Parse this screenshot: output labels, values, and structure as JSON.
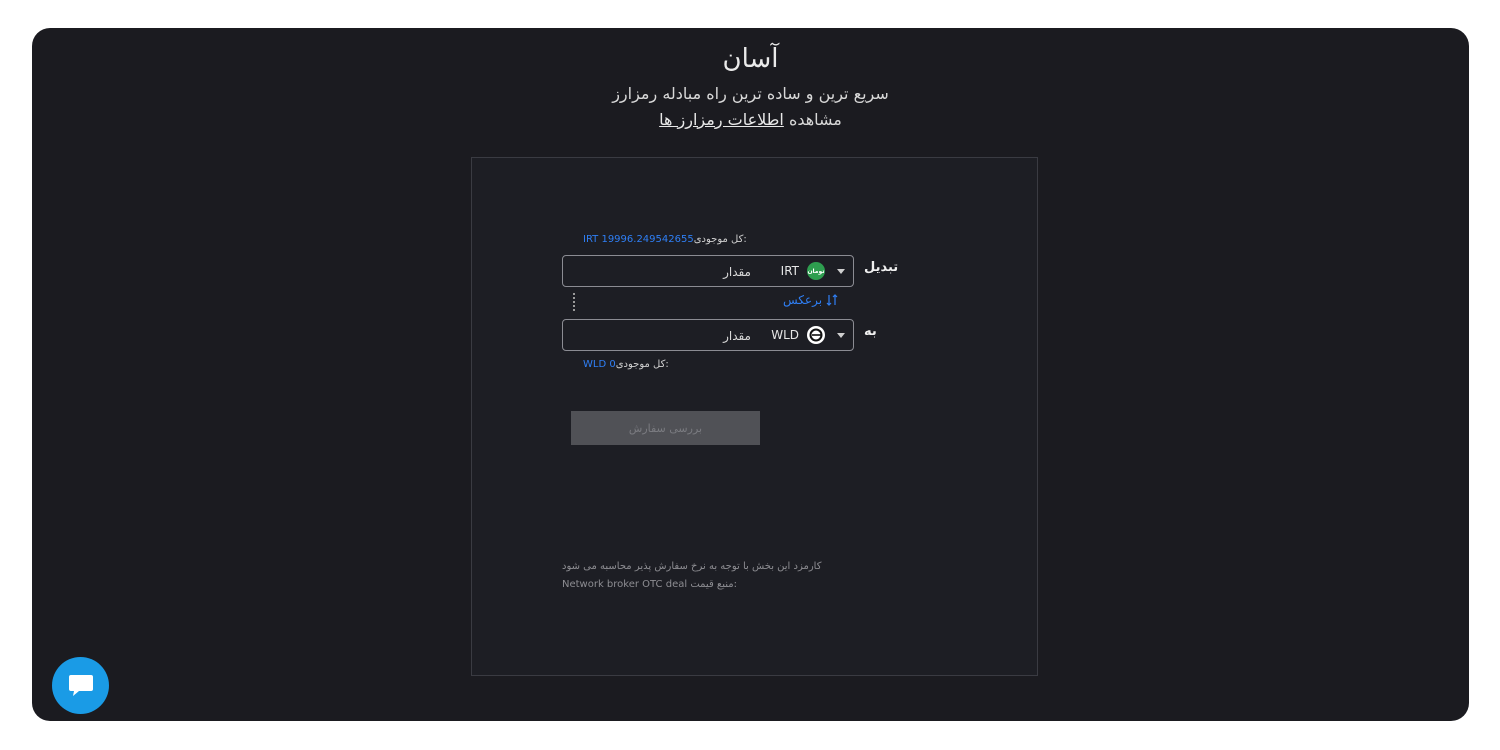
{
  "header": {
    "title": "آسان",
    "subtitle": "سریع ترین و ساده ترین راه مبادله رمزارز",
    "info_prefix": "مشاهده",
    "info_link": "اطلاعات رمزارز ها"
  },
  "form": {
    "from": {
      "label": "تبدیل",
      "balance_label": "کل موجودی:",
      "balance_value": "IRT 19996.249542655",
      "coin_code": "IRT",
      "coin_icon": "toman-coin-icon",
      "coin_icon_text": "تومان",
      "amount_placeholder": "مقدار"
    },
    "swap_label": "برعکس",
    "to": {
      "label": "به",
      "balance_label": "کل موجودی:",
      "balance_value": "WLD 0",
      "coin_code": "WLD",
      "coin_icon": "worldcoin-icon",
      "amount_placeholder": "مقدار"
    },
    "submit_label": "بررسی سفارش"
  },
  "notes": {
    "fee": "کارمزد این بخش با توجه به نرخ سفارش پذیر محاسبه می شود",
    "price_source_label": "منبع قیمت:",
    "price_source_value": "Network broker OTC deal"
  },
  "colors": {
    "background": "#1b1b20",
    "accent": "#2f7ff5",
    "chat_button": "#1a9be6",
    "toman_green": "#2e9e4f"
  }
}
